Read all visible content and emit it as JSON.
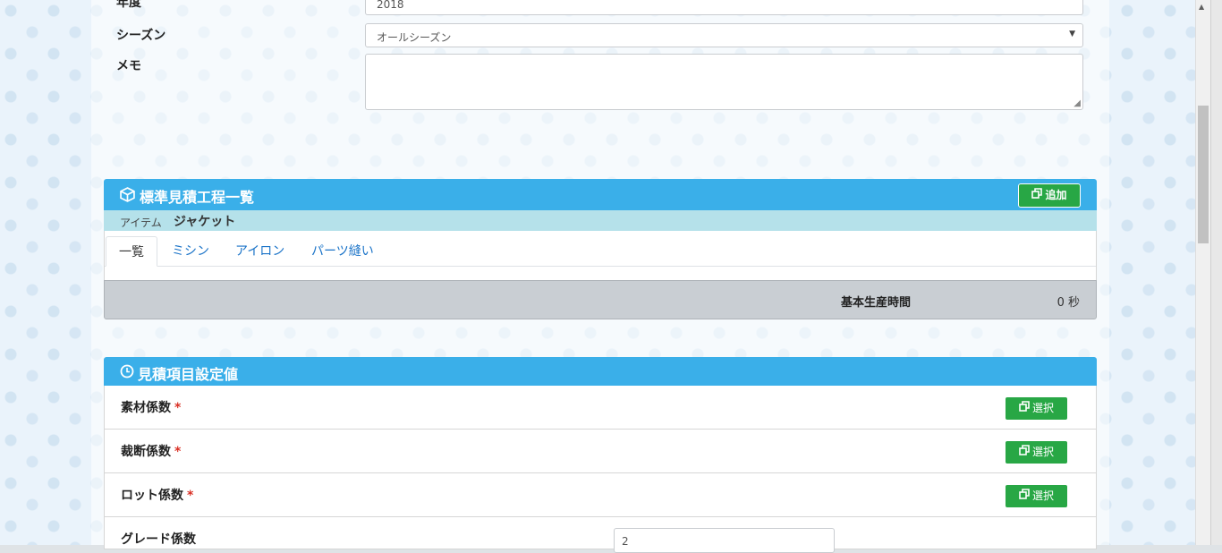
{
  "form": {
    "year_label": "年度",
    "year_value": "2018",
    "season_label": "シーズン",
    "season_value": "オールシーズン",
    "memo_label": "メモ",
    "memo_value": ""
  },
  "process_panel": {
    "title": "標準見積工程一覧",
    "add_button": "追加",
    "item_label": "アイテム",
    "item_value": "ジャケット",
    "tabs": [
      {
        "label": "一覧",
        "active": true
      },
      {
        "label": "ミシン",
        "active": false
      },
      {
        "label": "アイロン",
        "active": false
      },
      {
        "label": "パーツ縫い",
        "active": false
      }
    ],
    "summary_label": "基本生産時間",
    "summary_value": "0 秒"
  },
  "settings_panel": {
    "title": "見積項目設定値",
    "rows": [
      {
        "label": "素材係数",
        "required_mark": "*",
        "button": "選択"
      },
      {
        "label": "裁断係数",
        "required_mark": "*",
        "button": "選択"
      },
      {
        "label": "ロット係数",
        "required_mark": "*",
        "button": "選択"
      },
      {
        "label": "グレード係数",
        "input_value": "2"
      }
    ]
  },
  "colors": {
    "panel_header": "#3aafe9",
    "item_strip": "#b5e1ea",
    "button_green": "#28a745",
    "tab_link": "#1a73c8",
    "required": "#d93025"
  }
}
